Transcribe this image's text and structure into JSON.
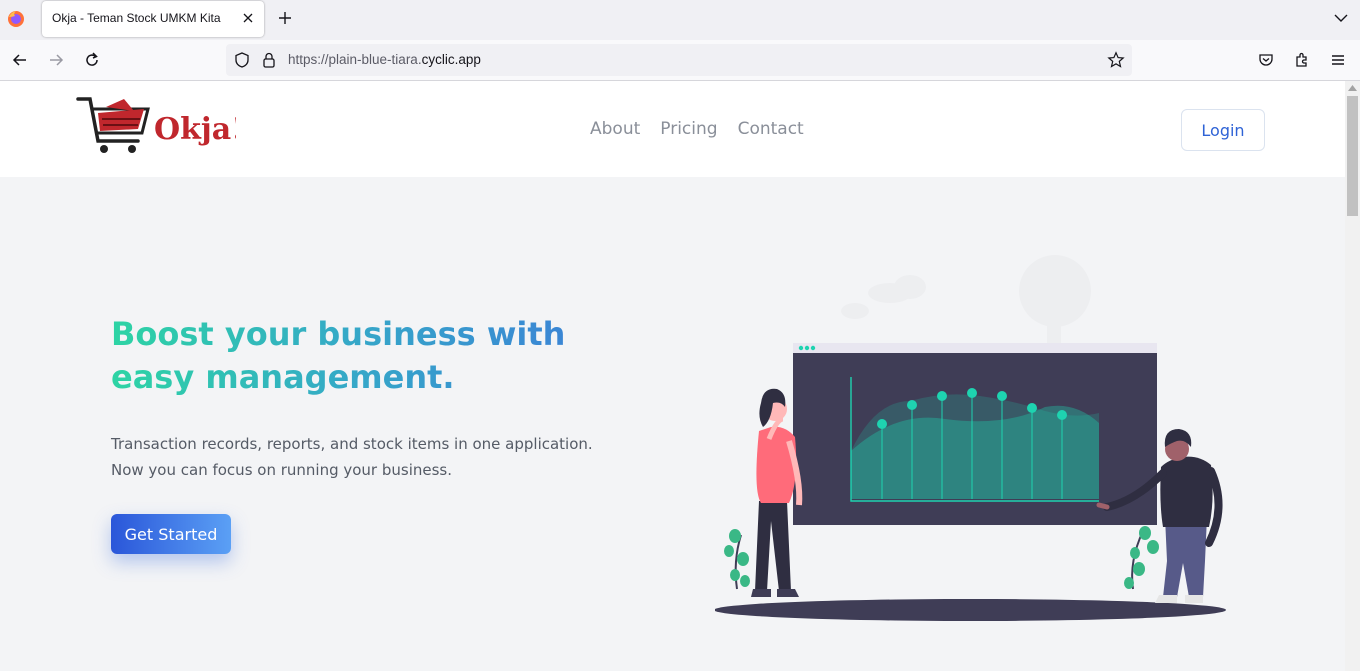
{
  "browser": {
    "tab_title": "Okja - Teman Stock UMKM Kita",
    "url_prefix": "https://plain-blue-tiara.",
    "url_host": "cyclic.app"
  },
  "site": {
    "logo_text": "Okja!",
    "nav": [
      "About",
      "Pricing",
      "Contact"
    ],
    "login_label": "Login"
  },
  "hero": {
    "title": "Boost your business with easy management.",
    "description_line1": "Transaction records, reports, and stock items in one application.",
    "description_line2": "Now you can focus on running your business.",
    "cta_label": "Get Started"
  },
  "colors": {
    "accent": "#2f63d6",
    "brand_red": "#c0272d",
    "chart_teal": "#1ed3b0"
  }
}
